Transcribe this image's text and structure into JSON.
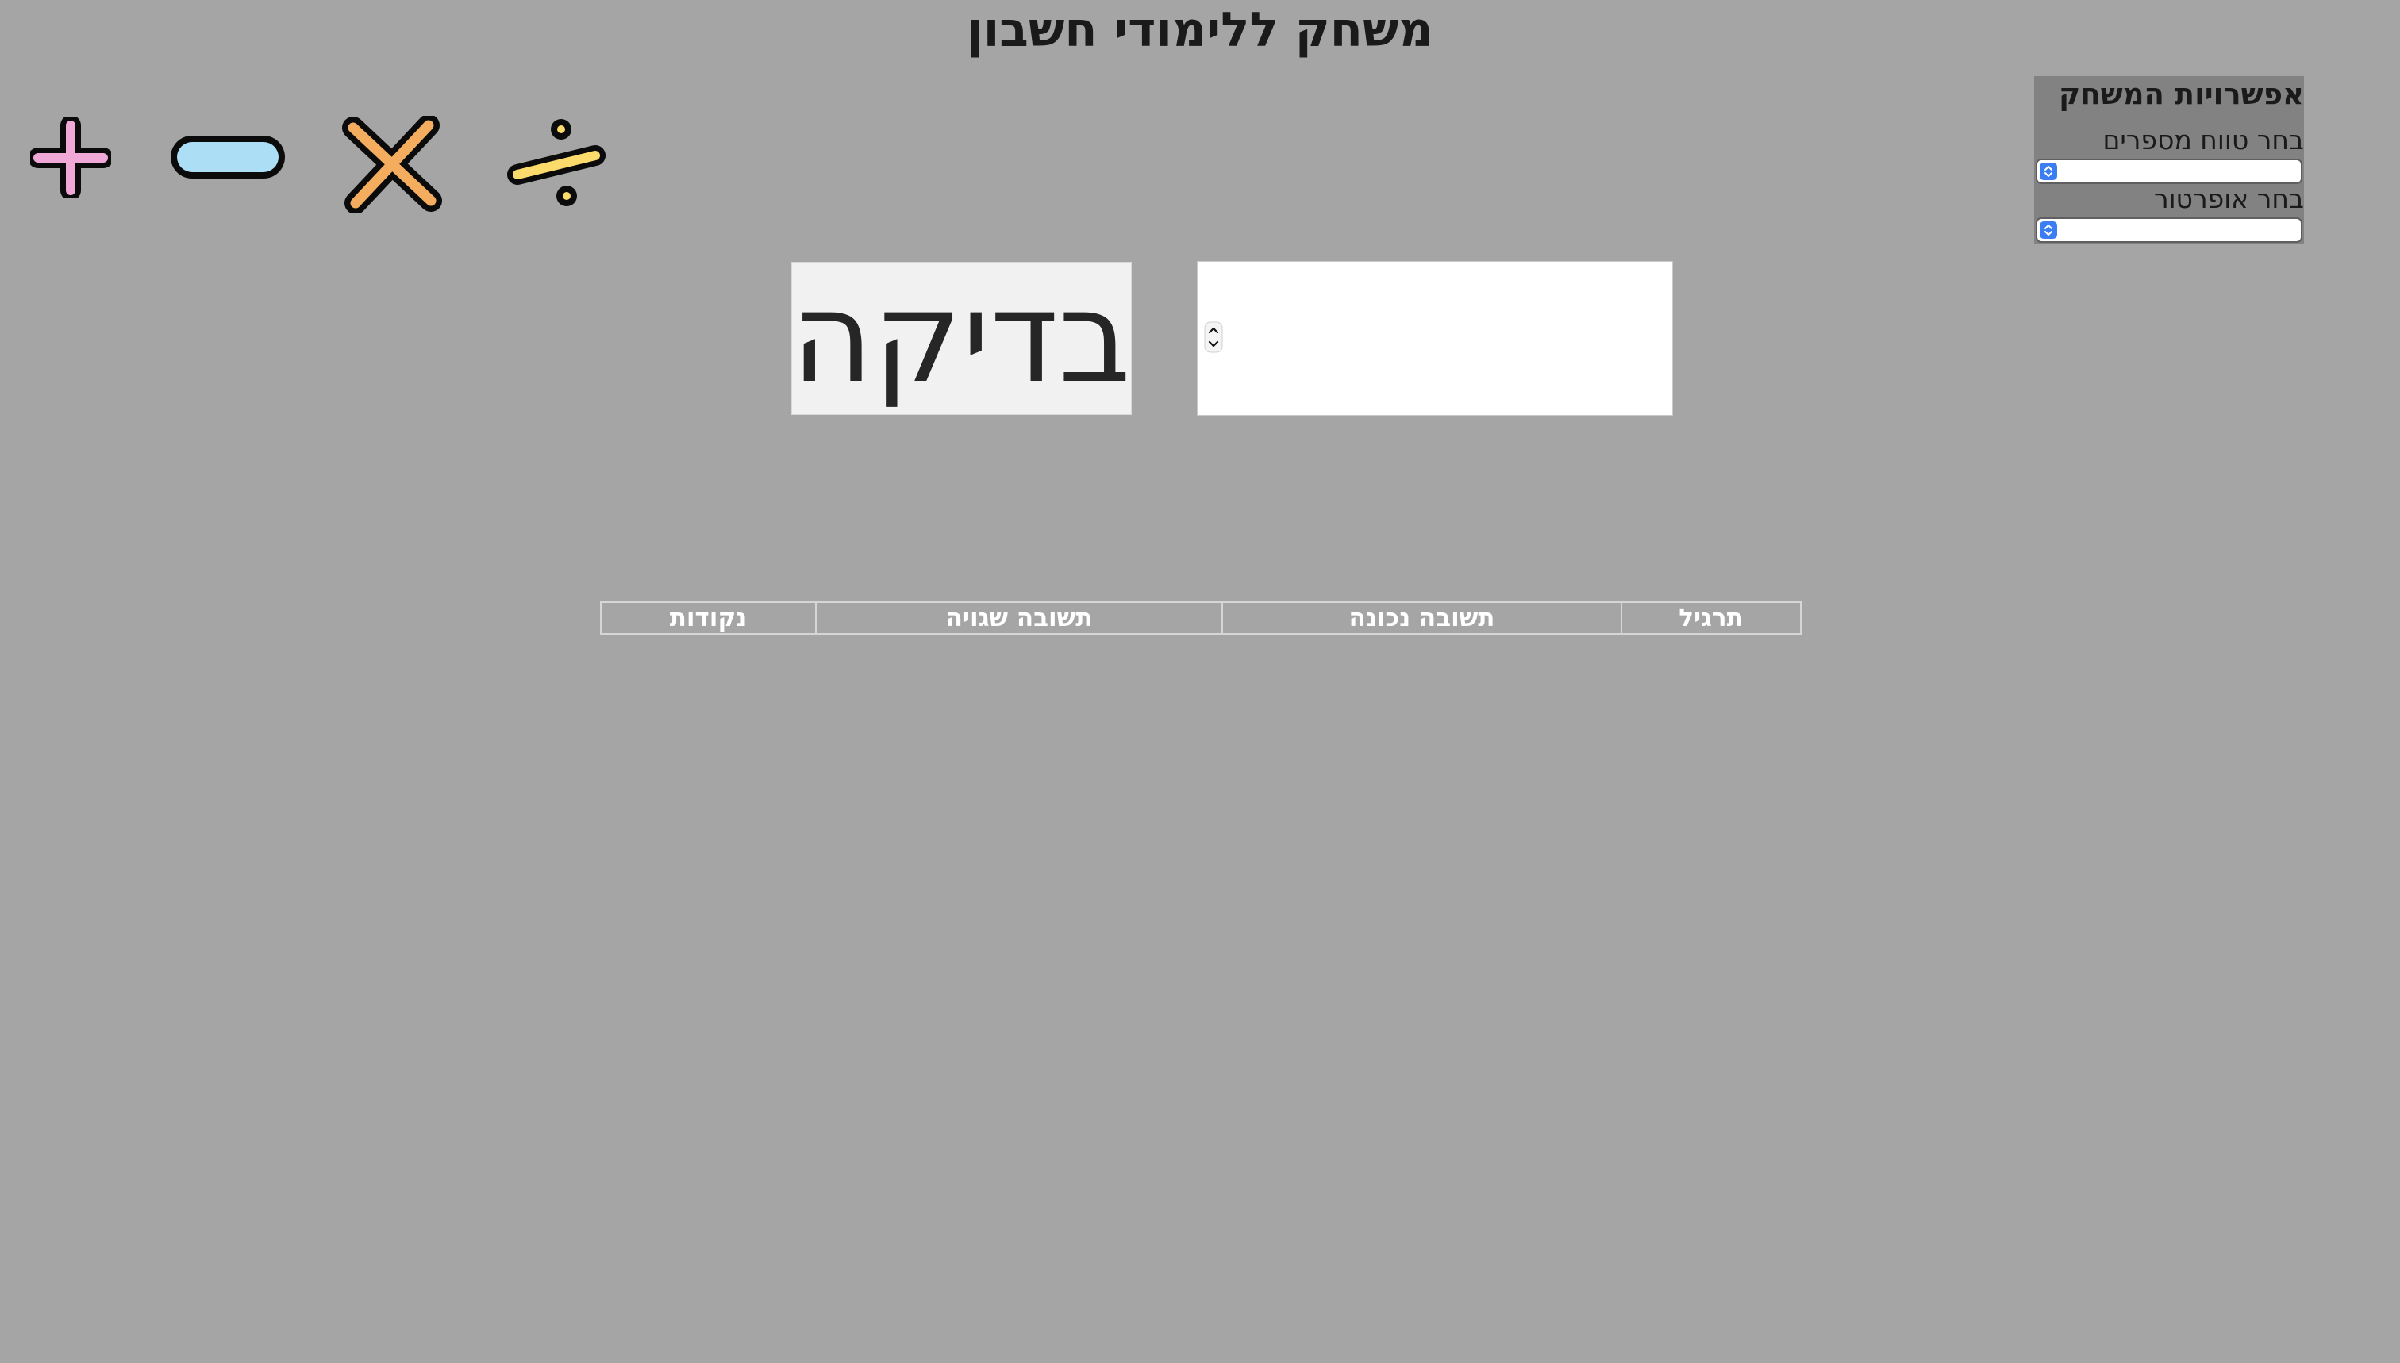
{
  "page": {
    "title": "משחק ללימודי חשבון",
    "background_color": "#a5a5a5"
  },
  "operators": [
    {
      "name": "plus",
      "icon": "plus-icon",
      "color": "#f0a9d6"
    },
    {
      "name": "minus",
      "icon": "minus-icon",
      "color": "#acdff5"
    },
    {
      "name": "multiply",
      "icon": "multiply-icon",
      "color": "#f4ad5e"
    },
    {
      "name": "divide",
      "icon": "divide-icon",
      "color": "#fbdb6b"
    }
  ],
  "settings": {
    "title": "אפשרויות המשחק",
    "range_label": "בחר טווח מספרים",
    "range_value": "",
    "operator_label": "בחר אופרטור",
    "operator_value": "",
    "panel_color": "#828282",
    "select_arrow_color": "#3b7ef4"
  },
  "check": {
    "label": "בדיקה"
  },
  "answer": {
    "value": ""
  },
  "table": {
    "headers": [
      "תרגיל",
      "תשובה נכונה",
      "תשובה שגויה",
      "נקודות"
    ]
  }
}
